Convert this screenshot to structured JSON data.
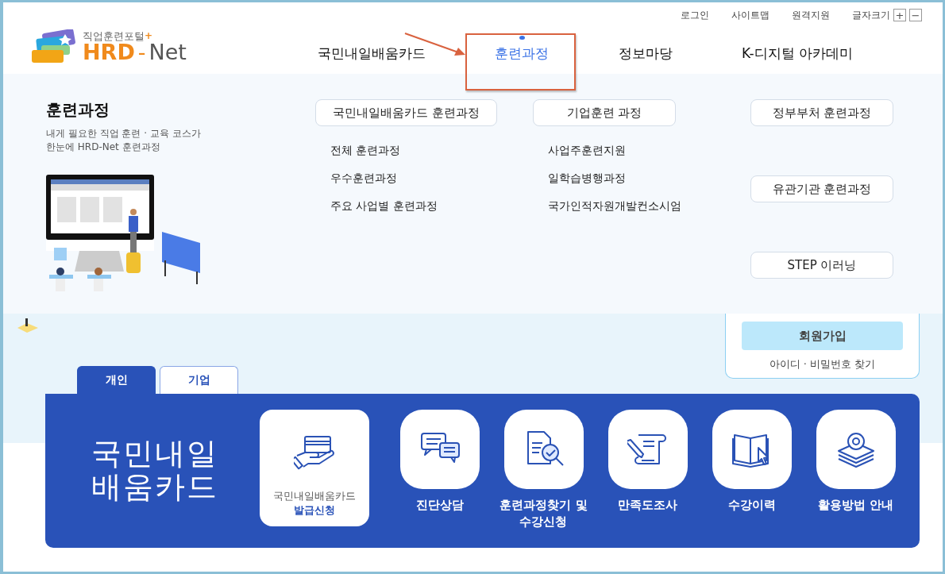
{
  "utility_links": [
    {
      "label": "로그인"
    },
    {
      "label": "사이트맵"
    },
    {
      "label": "원격지원"
    }
  ],
  "font_size": {
    "label": "글자크기",
    "buttons": [
      "+",
      "−"
    ]
  },
  "logo": {
    "tagline": "직업훈련포털",
    "plus": "+",
    "brand": "HRD",
    "dash": "-",
    "suffix": "Net"
  },
  "nav": [
    {
      "label": "국민내일배움카드",
      "selected": false,
      "annotated": false
    },
    {
      "label": "훈련과정",
      "selected": true,
      "annotated": true
    },
    {
      "label": "정보마당",
      "selected": false,
      "annotated": false
    },
    {
      "label": "K-디지털 아카데미",
      "selected": false,
      "annotated": false
    }
  ],
  "mega_menu": {
    "title": "훈련과정",
    "description": [
      "내게 필요한 직업 훈련 · 교육 코스가",
      "한눈에 HRD-Net 훈련과정"
    ],
    "columns": [
      [
        {
          "title": "국민내일배움카드 훈련과정",
          "links": [
            "전체 훈련과정",
            "우수훈련과정",
            "주요 사업별 훈련과정"
          ]
        }
      ],
      [
        {
          "title": "기업훈련 과정",
          "links": [
            "사업주훈련지원",
            "일학습병행과정",
            "국가인적자원개발컨소시엄"
          ]
        }
      ],
      [
        {
          "title": "정부부처 훈련과정"
        },
        {
          "title": "유관기관 훈련과정"
        },
        {
          "title": "STEP 이러닝"
        }
      ]
    ]
  },
  "login_box": {
    "signup_button": "회원가입",
    "find_link": "아이디 · 비밀번호 찾기"
  },
  "tabs": [
    {
      "label": "개인",
      "selected": true
    },
    {
      "label": "기업",
      "selected": false
    }
  ],
  "card_panel": {
    "title": [
      "국민내일",
      "배움카드"
    ],
    "services": [
      {
        "kind": "card",
        "lines": [
          "국민내일배움카드",
          "발급신청"
        ],
        "selected": true
      },
      {
        "kind": "help",
        "lines": [
          "진단상담"
        ],
        "selected": false
      },
      {
        "kind": "search",
        "lines": [
          "훈련과정찾기 및",
          "수강신청"
        ],
        "selected": false
      },
      {
        "kind": "survey",
        "lines": [
          "만족도조사"
        ],
        "selected": false
      },
      {
        "kind": "history",
        "lines": [
          "수강이력"
        ],
        "selected": false
      },
      {
        "kind": "guide",
        "lines": [
          "활용방법 안내"
        ],
        "selected": false
      }
    ]
  }
}
